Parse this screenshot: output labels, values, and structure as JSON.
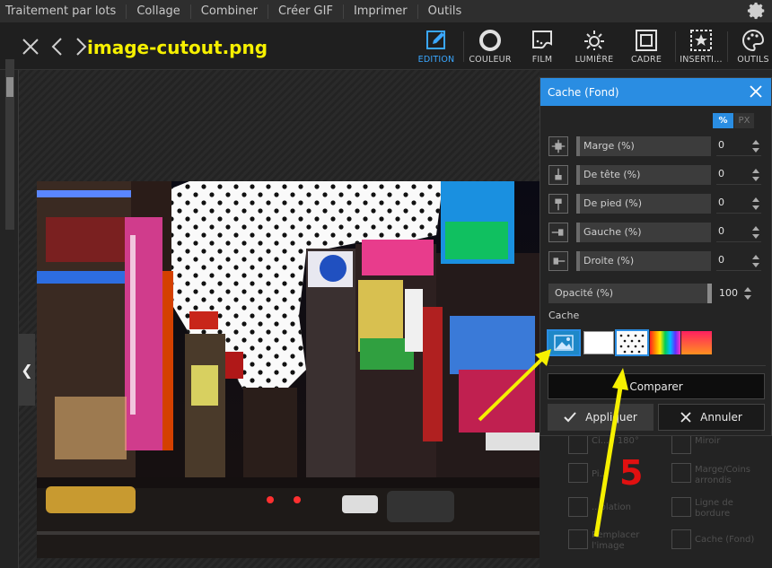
{
  "menu": {
    "items": [
      "Traitement par lots",
      "Collage",
      "Combiner",
      "Créer GIF",
      "Imprimer",
      "Outils"
    ]
  },
  "toolbar": {
    "filename": "image-cutout.png",
    "tools": [
      {
        "label": "EDITION",
        "icon": "edit-icon",
        "active": true
      },
      {
        "label": "COULEUR",
        "icon": "color-circle-icon",
        "active": false
      },
      {
        "label": "FILM",
        "icon": "film-icon",
        "active": false
      },
      {
        "label": "LUMIÈRE",
        "icon": "sun-icon",
        "active": false
      },
      {
        "label": "CADRE",
        "icon": "frame-icon",
        "active": false
      },
      {
        "label": "INSERTI...",
        "icon": "insert-star-icon",
        "active": false
      },
      {
        "label": "OUTILS",
        "icon": "palette-icon",
        "active": false
      }
    ]
  },
  "dialog": {
    "title": "Cache (Fond)",
    "unit_pct": "%",
    "unit_px": "PX",
    "fields": [
      {
        "label": "Marge (%)",
        "value": "0"
      },
      {
        "label": "De tête (%)",
        "value": "0"
      },
      {
        "label": "De pied (%)",
        "value": "0"
      },
      {
        "label": "Gauche (%)",
        "value": "0"
      },
      {
        "label": "Droite (%)",
        "value": "0"
      }
    ],
    "opacity_label": "Opacité (%)",
    "opacity_value": "100",
    "cache_label": "Cache",
    "compare_label": "Comparer",
    "apply_label": "Appliquer",
    "cancel_label": "Annuler"
  },
  "lower_panel": {
    "items": [
      "Ci...d 180°",
      "Miroir",
      "Pi...",
      "Marge/Coins arrondis",
      "...plation",
      "Ligne de bordure",
      "Remplacer l'image",
      "Cache (Fond)"
    ]
  },
  "annotation": {
    "step_number": "5"
  },
  "colors": {
    "accent": "#2a8de2",
    "filename": "#f6f000",
    "arrow": "#f6f000",
    "step_number": "#e01010"
  }
}
